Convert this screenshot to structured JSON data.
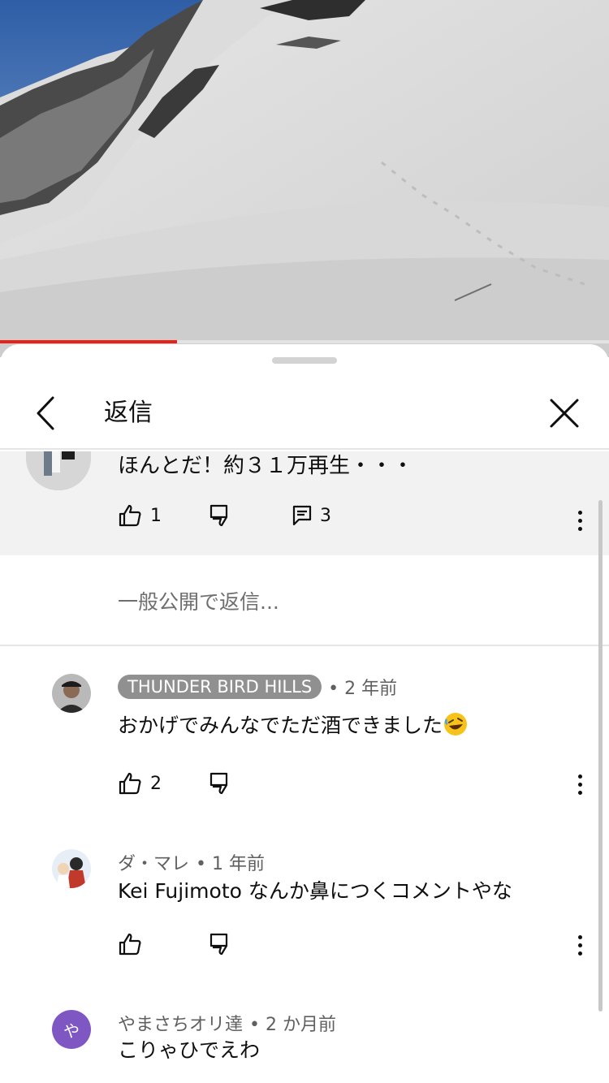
{
  "video": {
    "progress_percent": 29
  },
  "sheet": {
    "title": "返信"
  },
  "parent_comment": {
    "text": "ほんとだ！約３１万再生・・・",
    "likes": "1",
    "replies": "3"
  },
  "reply_input": {
    "placeholder": "一般公開で返信..."
  },
  "replies": [
    {
      "author": "THUNDER BIRD HILLS",
      "time": "• 2 年前",
      "text": "おかげでみんなでただ酒できました",
      "likes": "2"
    },
    {
      "author": "ダ・マレ",
      "time": "• 1 年前",
      "text": "Kei Fujimoto なんか鼻につくコメントやな",
      "likes": ""
    },
    {
      "author": "やまさちオリ達",
      "time": "• 2 か月前",
      "text": "こりゃひでえわ",
      "avatar_letter": "や",
      "avatar_color": "#7e57c2"
    }
  ]
}
